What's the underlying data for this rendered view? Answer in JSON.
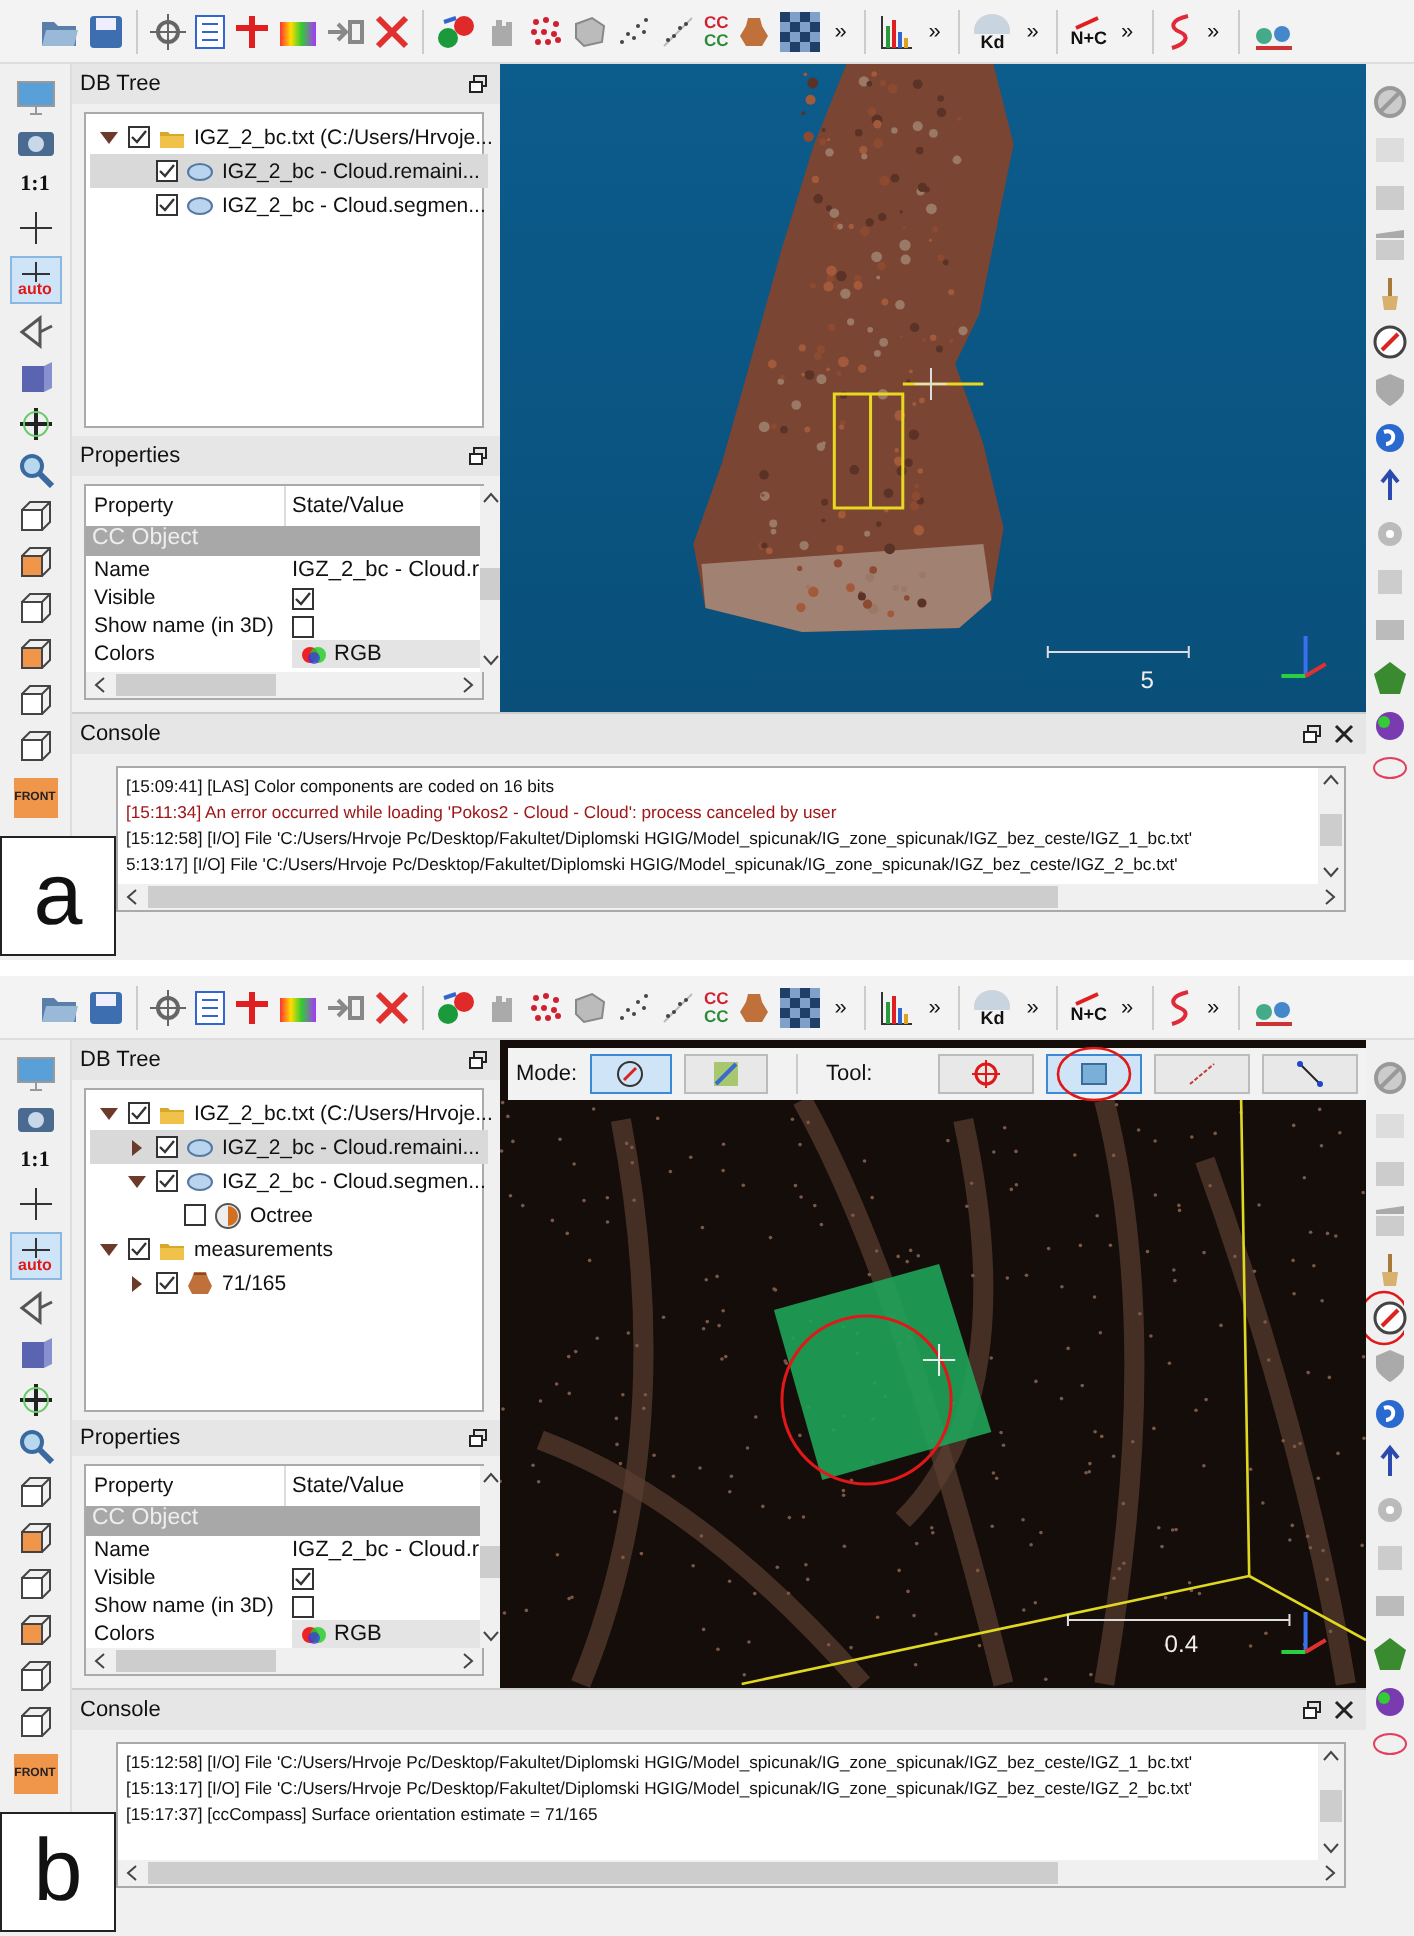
{
  "panels": [
    {
      "label": "a",
      "toolbar": {
        "cc_lines": [
          "CC",
          "CC"
        ],
        "kd_label": "Kd",
        "nc_label": "N+C",
        "overflow_marks": [
          "»",
          "»",
          "»",
          "»",
          "»"
        ]
      },
      "left_toolbar": {
        "scale_label": "1:1",
        "auto_label": "auto",
        "auto_selected": true,
        "front_label": "FRONT"
      },
      "right_toolbar": {
        "compass_circled": false
      },
      "db_tree": {
        "title": "DB Tree",
        "items": [
          {
            "label": "IGZ_2_bc.txt (C:/Users/Hrvoje...",
            "kind": "group",
            "checked": true,
            "expanded": true,
            "selected": false,
            "children": [
              {
                "label": "IGZ_2_bc - Cloud.remaini...",
                "kind": "cloud",
                "checked": true,
                "selected": true
              },
              {
                "label": "IGZ_2_bc - Cloud.segmen...",
                "kind": "cloud",
                "checked": true,
                "selected": false
              }
            ]
          }
        ]
      },
      "properties": {
        "title": "Properties",
        "columns": [
          "Property",
          "State/Value"
        ],
        "section": "CC Object",
        "rows": [
          {
            "property": "Name",
            "kind": "text",
            "value": "IGZ_2_bc - Cloud.r"
          },
          {
            "property": "Visible",
            "kind": "checkbox",
            "checked": true
          },
          {
            "property": "Show name (in 3D)",
            "kind": "checkbox",
            "checked": false
          },
          {
            "property": "Colors",
            "kind": "colors",
            "value": "RGB"
          }
        ]
      },
      "view": {
        "kind": "outcrop",
        "scale_label": "5"
      },
      "console": {
        "title": "Console",
        "lines": [
          {
            "kind": "info",
            "text": "[15:09:41] [LAS] Color components are coded on 16 bits"
          },
          {
            "kind": "error",
            "text": "[15:11:34] An error occurred while loading 'Pokos2 - Cloud - Cloud': process canceled by user"
          },
          {
            "kind": "info",
            "text": "[15:12:58] [I/O] File 'C:/Users/Hrvoje Pc/Desktop/Fakultet/Diplomski HGIG/Model_spicunak/IG_zone_spicunak/IGZ_bez_ceste/IGZ_1_bc.txt'"
          },
          {
            "kind": "info",
            "text": "5:13:17] [I/O] File 'C:/Users/Hrvoje Pc/Desktop/Fakultet/Diplomski HGIG/Model_spicunak/IG_zone_spicunak/IGZ_bez_ceste/IGZ_2_bc.txt'"
          }
        ]
      }
    },
    {
      "label": "b",
      "toolbar": {
        "cc_lines": [
          "CC",
          "CC"
        ],
        "kd_label": "Kd",
        "nc_label": "N+C",
        "overflow_marks": [
          "»",
          "»",
          "»",
          "»",
          "»"
        ]
      },
      "left_toolbar": {
        "scale_label": "1:1",
        "auto_label": "auto",
        "auto_selected": true,
        "front_label": "FRONT"
      },
      "right_toolbar": {
        "compass_circled": true
      },
      "db_tree": {
        "title": "DB Tree",
        "items": [
          {
            "label": "IGZ_2_bc.txt (C:/Users/Hrvoje...",
            "kind": "group",
            "checked": true,
            "expanded": true,
            "selected": false,
            "children": [
              {
                "label": "IGZ_2_bc - Cloud.remaini...",
                "kind": "cloud",
                "checked": true,
                "expanded": false,
                "selected": true
              },
              {
                "label": "IGZ_2_bc - Cloud.segmen...",
                "kind": "cloud",
                "checked": true,
                "expanded": true,
                "selected": false,
                "children": [
                  {
                    "label": "Octree",
                    "kind": "octree",
                    "checked": false,
                    "selected": false
                  }
                ]
              }
            ]
          },
          {
            "label": "measurements",
            "kind": "group",
            "checked": true,
            "expanded": true,
            "selected": false,
            "children": [
              {
                "label": "71/165",
                "kind": "measurement",
                "checked": true,
                "expanded": false,
                "selected": false
              }
            ]
          }
        ]
      },
      "properties": {
        "title": "Properties",
        "columns": [
          "Property",
          "State/Value"
        ],
        "section": "CC Object",
        "rows": [
          {
            "property": "Name",
            "kind": "text",
            "value": "IGZ_2_bc - Cloud.r"
          },
          {
            "property": "Visible",
            "kind": "checkbox",
            "checked": true
          },
          {
            "property": "Show name (in 3D)",
            "kind": "checkbox",
            "checked": false
          },
          {
            "property": "Colors",
            "kind": "colors",
            "value": "RGB"
          }
        ]
      },
      "view": {
        "kind": "compass",
        "scale_label": "0.4",
        "overlay": {
          "mode_label": "Mode:",
          "modes": [
            {
              "selected": true
            },
            {
              "selected": false
            }
          ],
          "tool_label": "Tool:",
          "tools": [
            {
              "selected": false,
              "circled": false
            },
            {
              "selected": true,
              "circled": true
            },
            {
              "selected": false,
              "circled": false
            },
            {
              "selected": false,
              "circled": false
            }
          ]
        }
      },
      "console": {
        "title": "Console",
        "lines": [
          {
            "kind": "info",
            "text": "[15:12:58] [I/O] File 'C:/Users/Hrvoje Pc/Desktop/Fakultet/Diplomski HGIG/Model_spicunak/IG_zone_spicunak/IGZ_bez_ceste/IGZ_1_bc.txt'"
          },
          {
            "kind": "info",
            "text": "[15:13:17] [I/O] File 'C:/Users/Hrvoje Pc/Desktop/Fakultet/Diplomski HGIG/Model_spicunak/IG_zone_spicunak/IGZ_bez_ceste/IGZ_2_bc.txt'"
          },
          {
            "kind": "info",
            "text": "[15:17:37] [ccCompass] Surface orientation estimate = 71/165"
          }
        ]
      }
    }
  ]
}
